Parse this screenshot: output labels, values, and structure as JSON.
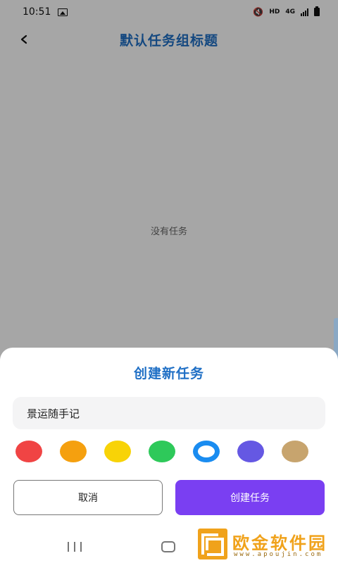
{
  "status_bar": {
    "time": "10:51",
    "network_hd": "HD",
    "network_4g": "4G"
  },
  "header": {
    "back_icon": "chevron-left-icon",
    "title": "默认任务组标题"
  },
  "main": {
    "empty_text": "没有任务"
  },
  "dialog": {
    "title": "创建新任务",
    "input_value": "景运随手记",
    "colors": [
      {
        "hex": "#f04444",
        "selected": false
      },
      {
        "hex": "#f5a00f",
        "selected": false
      },
      {
        "hex": "#f8d307",
        "selected": false
      },
      {
        "hex": "#2ec95a",
        "selected": false
      },
      {
        "hex": "#1a8cf0",
        "selected": true
      },
      {
        "hex": "#6558e3",
        "selected": false
      },
      {
        "hex": "#c7a46e",
        "selected": false
      }
    ],
    "cancel_label": "取消",
    "create_label": "创建任务"
  },
  "watermark": {
    "text": "欧金软件园",
    "url": "www.apoujin.com"
  },
  "theme": {
    "accent": "#1f6fc5",
    "primary_button": "#7a3ff2"
  }
}
